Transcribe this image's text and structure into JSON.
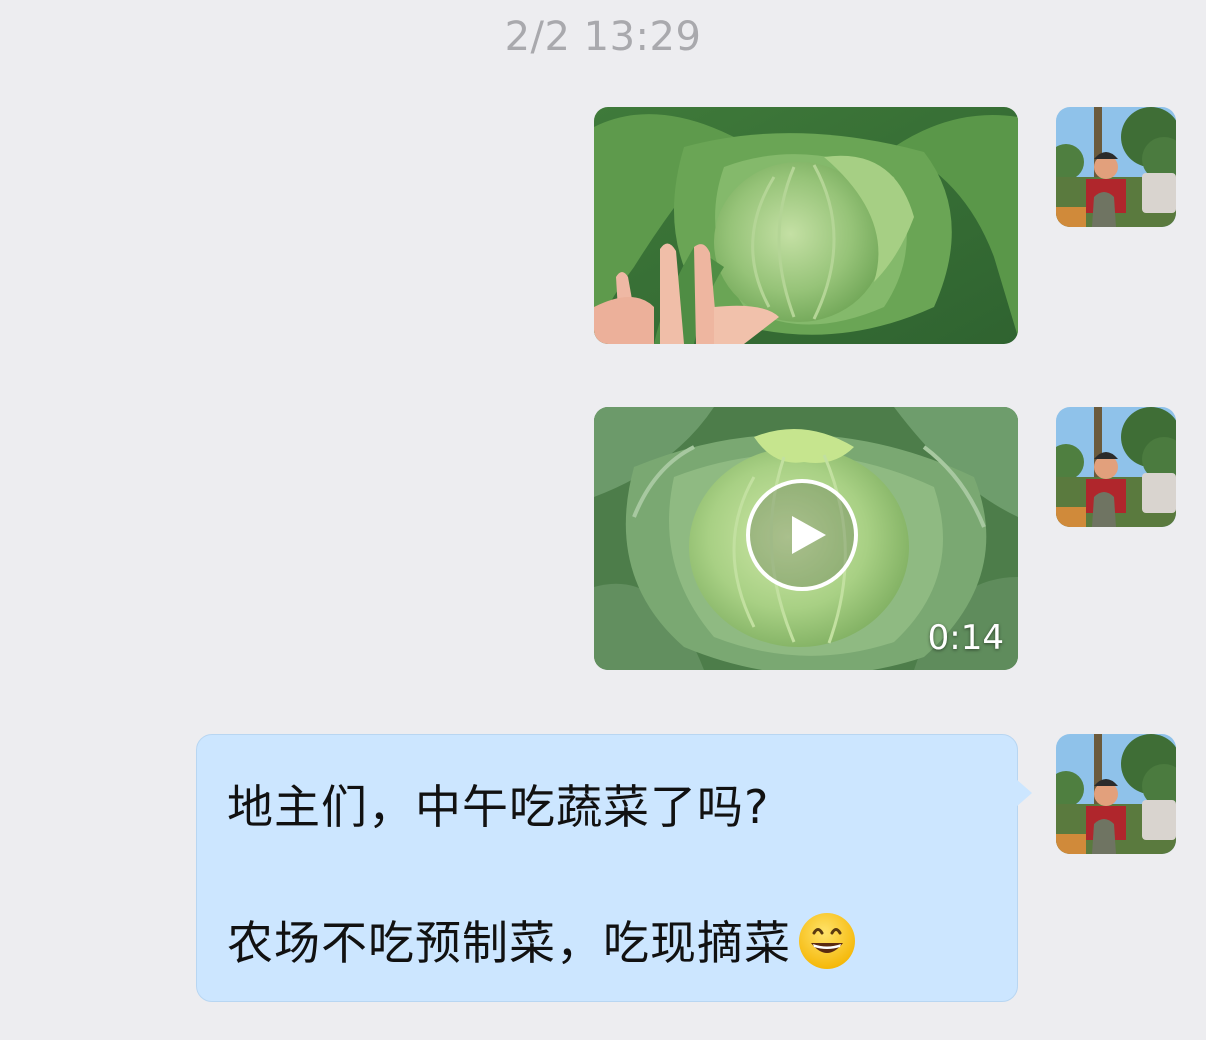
{
  "chat": {
    "timestamp": "2/2 13:29",
    "messages": [
      {
        "type": "image",
        "subject": "cabbage-photo"
      },
      {
        "type": "video",
        "subject": "cabbage-video",
        "duration": "0:14"
      },
      {
        "type": "text",
        "line1": "地主们，中午吃蔬菜了吗?",
        "line2": "农场不吃预制菜，吃现摘菜",
        "emoji": "grinning-face-icon"
      }
    ],
    "colors": {
      "background": "#ededf0",
      "bubble": "#cce6ff",
      "timestamp": "#a9a9ad"
    }
  }
}
